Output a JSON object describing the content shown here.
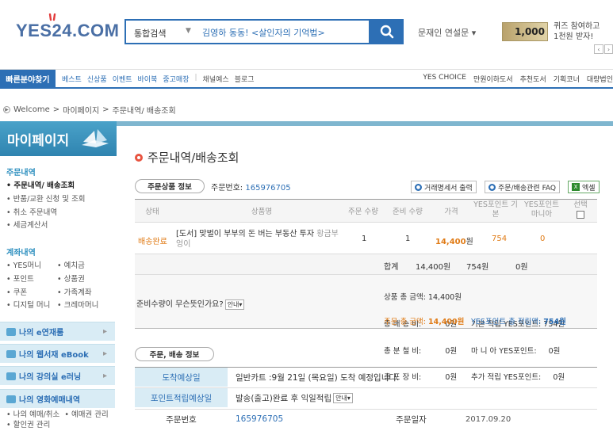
{
  "header": {
    "logo": {
      "left": "YES24",
      "right": ".COM"
    },
    "search_category": "통합검색",
    "search_value": "김영하 동동! <살인자의 기억법>",
    "user_link": "문재인 연설문 ▾",
    "promo_amount": "1,000",
    "promo_line1": "퀴즈 참여하고",
    "promo_line2": "1천원 받자!",
    "pager_prev": "‹",
    "pager_next": "›"
  },
  "nav": {
    "main": "빠른분야찾기",
    "links": [
      "베스트",
      "신상품",
      "이벤트",
      "바이북",
      "중고매장"
    ],
    "links2": [
      "채널예스",
      "블로그"
    ],
    "right": [
      "YES CHOICE",
      "만원이하도서",
      "추천도서",
      "기획코너",
      "대량법인"
    ]
  },
  "breadcrumb": [
    "Welcome",
    ">",
    "마이페이지",
    ">",
    "주문내역/ 배송조회"
  ],
  "sidebar": {
    "title": "마이페이지",
    "section1": "주문내역",
    "items1": [
      "주문내역/ 배송조회",
      "반품/교환 신청 및 조회",
      "취소 주문내역",
      "세금계산서"
    ],
    "section2": "계좌내역",
    "pairs": [
      [
        "YES머니",
        "예치금"
      ],
      [
        "포인트",
        "상품권"
      ],
      [
        "쿠폰",
        "가족계좌"
      ],
      [
        "디지털 머니",
        "크레마머니"
      ]
    ],
    "boxes": [
      "나의 e연재룸",
      "나의 웹서재 eBook",
      "나의 강의실 e러닝",
      "나의 영화예매내역"
    ],
    "bottom": [
      "나의 예매/취소",
      "예매권 관리",
      "할인권 관리"
    ]
  },
  "main": {
    "title": "주문내역/배송조회",
    "tab1": "주문상품 정보",
    "order_no_label": "주문번호:",
    "order_no": "165976705",
    "btn_receipt": "거래명세서 출력",
    "btn_faq": "주문/배송관련 FAQ",
    "btn_excel": "엑셀",
    "columns": [
      "상태",
      "상품명",
      "주문 수량",
      "준비 수량",
      "가격",
      "YES포인트 기본",
      "YES포인트 마니아",
      "선택"
    ],
    "row": {
      "status": "배송완료",
      "name": "[도서] 맞벌이 부부의 돈 버는 부동산 투자",
      "author": "황금부엉이",
      "qty_order": "1",
      "qty_ready": "1",
      "price": "14,400",
      "price_unit": "원",
      "point_basic": "754",
      "point_mania": "0"
    },
    "sum": {
      "label": "합계",
      "price": "14,400원",
      "point_basic": "754원",
      "point_mania": "0원"
    },
    "question": "준비수량이 무슨뜻인가요?",
    "guide_btn": "안내▾",
    "detail_lines_left": [
      "상품 총 금액: 14,400원",
      "총 배 송 비:          0원",
      "총 분 철 비:          0원",
      "총 포 장 비:          0원"
    ],
    "detail_lines_right": [
      "",
      "기본 적립 YES포인트: 754원",
      "마 니 아 YES포인트:     0원",
      "추가 적립 YES포인트:     0원"
    ],
    "total_label": "주문 총 금액:",
    "total_value": "14,400원",
    "total_point_label": "YES포인트 총 적립액:",
    "total_point_value": "754원",
    "tab2": "주문, 배송 정보",
    "arrival_label": "도착예상일",
    "arrival_value": "일반카트 :9월 21일 (목요일) 도착 예정입니다.",
    "point_date_label": "포인트적립예상일",
    "point_date_value": "발송(출고)완료 후 익일적립",
    "order_no_label2": "주문번호",
    "order_no2": "165976705",
    "order_date_label": "주문일자",
    "order_date": "2017.09.20"
  }
}
